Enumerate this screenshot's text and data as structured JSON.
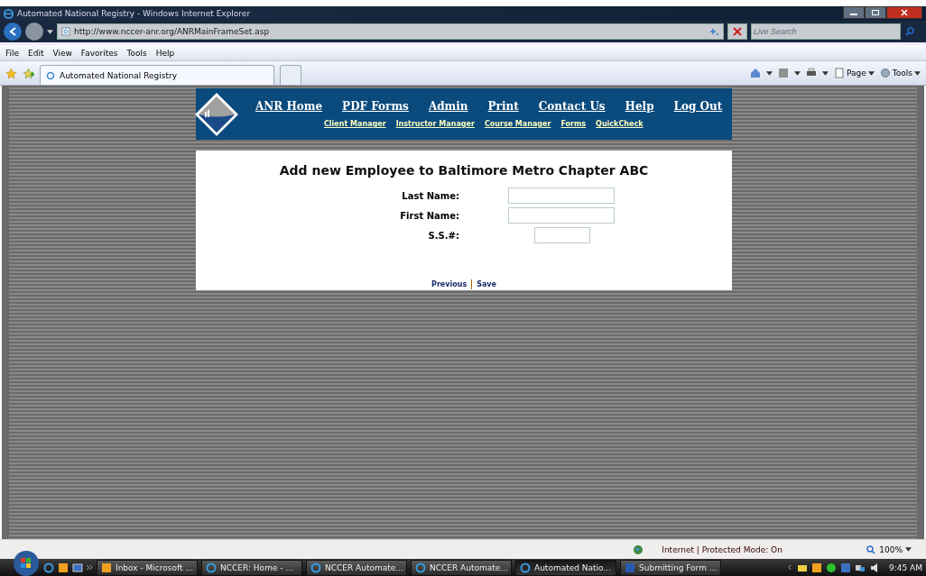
{
  "window": {
    "title": "Automated National Registry - Windows Internet Explorer"
  },
  "address_bar": {
    "url": "http://www.nccer-anr.org/ANRMainFrameSet.asp"
  },
  "search": {
    "placeholder": "Live Search"
  },
  "menu": [
    "File",
    "Edit",
    "View",
    "Favorites",
    "Tools",
    "Help"
  ],
  "tabs": [
    {
      "label": "Automated National Registry",
      "selected": true
    }
  ],
  "command_bar": [
    "Page",
    "Tools"
  ],
  "site_nav": {
    "primary": [
      "ANR Home",
      "PDF Forms",
      "Admin",
      "Print",
      "Contact Us",
      "Help",
      "Log Out"
    ],
    "secondary": [
      "Client Manager",
      "Instructor Manager",
      "Course Manager",
      "Forms",
      "QuickCheck"
    ]
  },
  "form": {
    "heading_prefix": "Add new Employee to ",
    "heading_org": "Baltimore Metro Chapter ABC",
    "fields": [
      {
        "label": "Last Name:",
        "kind": "wide"
      },
      {
        "label": "First Name:",
        "kind": "wide"
      },
      {
        "label": "S.S.#:",
        "kind": "narrow"
      }
    ],
    "links": [
      "Previous",
      "Save"
    ]
  },
  "status_bar": {
    "zone": "Internet | Protected Mode: On",
    "zoom": "100%"
  },
  "taskbar": {
    "items": [
      {
        "label": "Inbox - Microsoft ...",
        "kind": "mail",
        "selected": false
      },
      {
        "label": "NCCER: Home - ...",
        "kind": "ie",
        "selected": false
      },
      {
        "label": "NCCER Automate...",
        "kind": "ie",
        "selected": false
      },
      {
        "label": "NCCER Automate...",
        "kind": "ie",
        "selected": false
      },
      {
        "label": "Automated Natio...",
        "kind": "ie",
        "selected": true
      },
      {
        "label": "Submitting Form ...",
        "kind": "doc",
        "selected": false
      }
    ],
    "clock": "9:45 AM"
  }
}
